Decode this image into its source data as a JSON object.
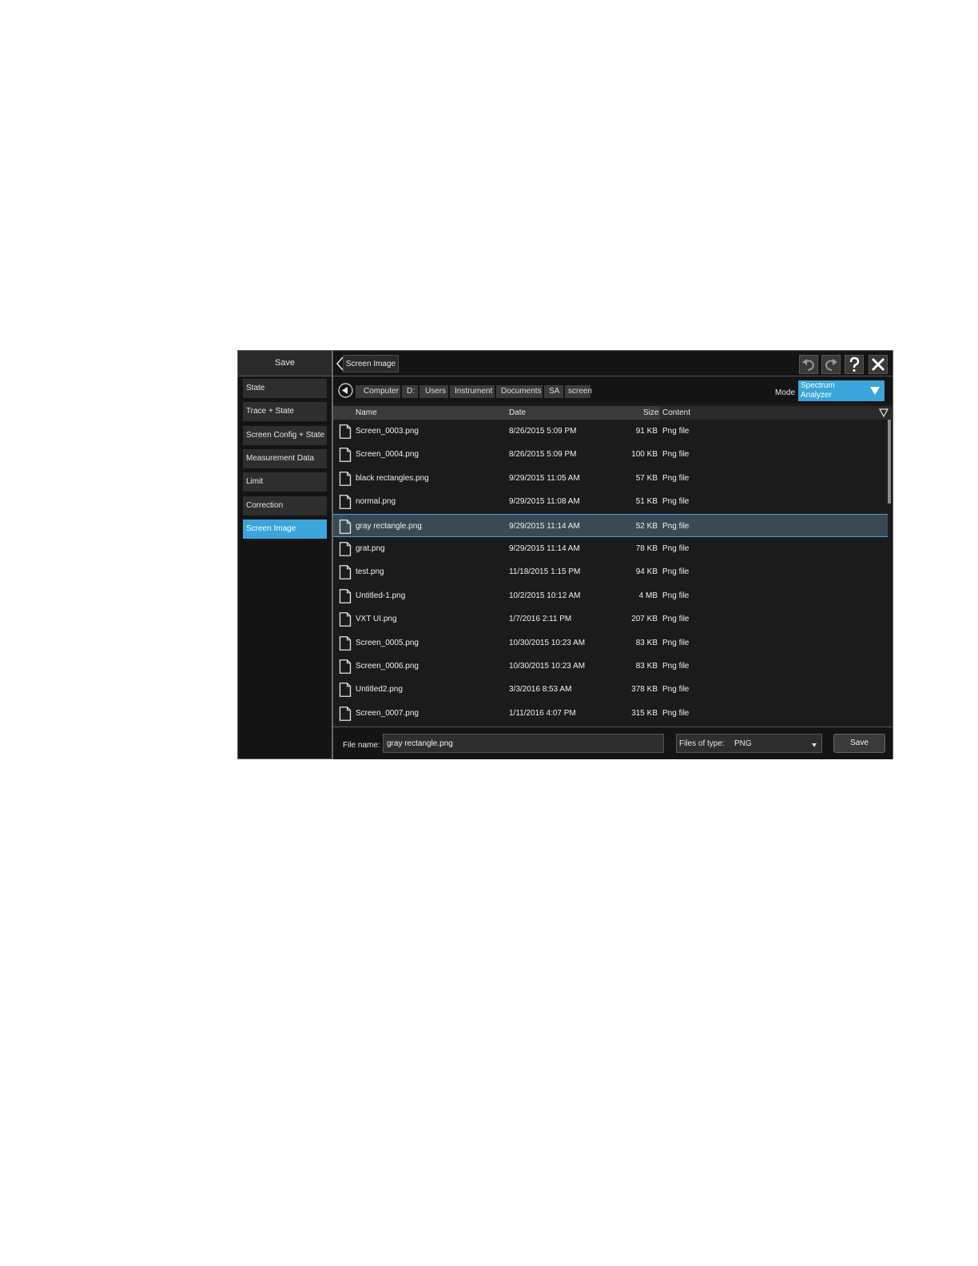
{
  "left_panel": {
    "title": "Save",
    "items": [
      {
        "label": "State",
        "selected": false
      },
      {
        "label": "Trace + State",
        "selected": false
      },
      {
        "label": "Screen Config + State",
        "selected": false
      },
      {
        "label": "Measurement Data",
        "selected": false
      },
      {
        "label": "Limit",
        "selected": false
      },
      {
        "label": "Correction",
        "selected": false
      },
      {
        "label": "Screen Image",
        "selected": true
      }
    ]
  },
  "header": {
    "tab_label": "Screen Image",
    "icons": [
      "undo-icon",
      "redo-icon",
      "help-icon",
      "close-icon"
    ]
  },
  "path": {
    "crumbs": [
      "Computer",
      "D:",
      "Users",
      "Instrument",
      "Documents",
      "SA",
      "screen"
    ]
  },
  "mode": {
    "label": "Mode",
    "value_line1": "Spectrum",
    "value_line2": "Analyzer"
  },
  "table": {
    "columns": {
      "name": "Name",
      "date": "Date",
      "size": "Size",
      "content": "Content"
    },
    "rows": [
      {
        "name": "Screen_0003.png",
        "date": "8/26/2015 5:09 PM",
        "size": "91 KB",
        "content": "Png file"
      },
      {
        "name": "Screen_0004.png",
        "date": "8/26/2015 5:09 PM",
        "size": "100 KB",
        "content": "Png file"
      },
      {
        "name": "black rectangles.png",
        "date": "9/29/2015 11:05 AM",
        "size": "57 KB",
        "content": "Png file"
      },
      {
        "name": "normal.png",
        "date": "9/29/2015 11:08 AM",
        "size": "51 KB",
        "content": "Png file"
      },
      {
        "name": "gray rectangle.png",
        "date": "9/29/2015 11:14 AM",
        "size": "52 KB",
        "content": "Png file"
      },
      {
        "name": "grat.png",
        "date": "9/29/2015 11:14 AM",
        "size": "78 KB",
        "content": "Png file"
      },
      {
        "name": "test.png",
        "date": "11/18/2015 1:15 PM",
        "size": "94 KB",
        "content": "Png file"
      },
      {
        "name": "Untitled-1.png",
        "date": "10/2/2015 10:12 AM",
        "size": "4 MB",
        "content": "Png file"
      },
      {
        "name": "VXT UI.png",
        "date": "1/7/2016 2:11 PM",
        "size": "207 KB",
        "content": "Png file"
      },
      {
        "name": "Screen_0005.png",
        "date": "10/30/2015 10:23 AM",
        "size": "83 KB",
        "content": "Png file"
      },
      {
        "name": "Screen_0006.png",
        "date": "10/30/2015 10:23 AM",
        "size": "83 KB",
        "content": "Png file"
      },
      {
        "name": "Untitled2.png",
        "date": "3/3/2016 8:53 AM",
        "size": "378 KB",
        "content": "Png file"
      },
      {
        "name": "Screen_0007.png",
        "date": "1/11/2016 4:07 PM",
        "size": "315 KB",
        "content": "Png file"
      }
    ],
    "selected_index": 4
  },
  "footer": {
    "file_name_label": "File name:",
    "file_name_value": "gray rectangle.png",
    "files_of_type_label": "Files of type:",
    "files_of_type_value": "PNG",
    "save_label": "Save"
  },
  "colors": {
    "accent": "#3aa6dc",
    "background": "#1b1b1b"
  }
}
